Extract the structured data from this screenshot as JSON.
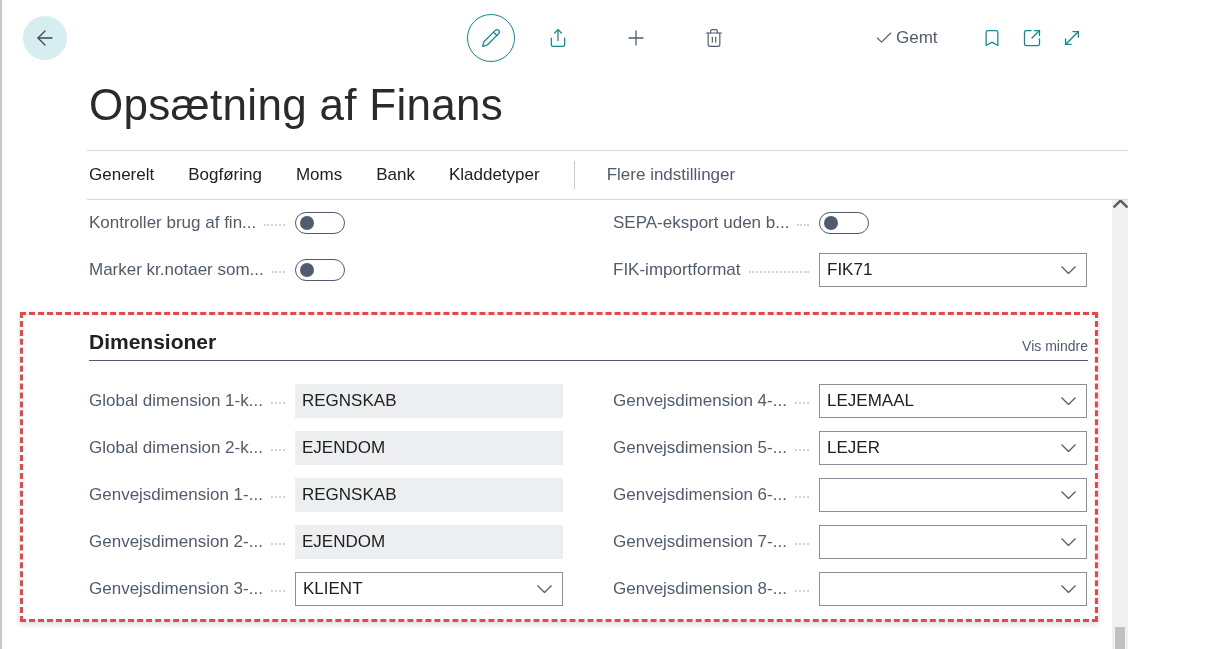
{
  "toolbar": {
    "status": "Gemt"
  },
  "title": "Opsætning af Finans",
  "tabs": [
    {
      "label": "Generelt"
    },
    {
      "label": "Bogføring"
    },
    {
      "label": "Moms"
    },
    {
      "label": "Bank"
    },
    {
      "label": "Kladdetyper"
    }
  ],
  "more_tab": "Flere indstillinger",
  "top_fields": {
    "columns": [
      [
        {
          "label": "Kontroller brug af fin...",
          "kind": "toggle",
          "on": false
        },
        {
          "label": "Marker kr.notaer som...",
          "kind": "toggle",
          "on": false
        }
      ],
      [
        {
          "label": "SEPA-eksport uden b...",
          "kind": "toggle",
          "on": false
        },
        {
          "label": "FIK-importformat",
          "kind": "dropdown",
          "value": "FIK71"
        }
      ]
    ]
  },
  "section": {
    "title": "Dimensioner",
    "toggle_link": "Vis mindre",
    "columns": [
      [
        {
          "label": "Global dimension 1-k...",
          "kind": "readonly",
          "value": "REGNSKAB"
        },
        {
          "label": "Global dimension 2-k...",
          "kind": "readonly",
          "value": "EJENDOM"
        },
        {
          "label": "Genvejsdimension 1-...",
          "kind": "readonly",
          "value": "REGNSKAB"
        },
        {
          "label": "Genvejsdimension 2-...",
          "kind": "readonly",
          "value": "EJENDOM"
        },
        {
          "label": "Genvejsdimension 3-...",
          "kind": "dropdown",
          "value": "KLIENT"
        }
      ],
      [
        {
          "label": "Genvejsdimension 4-...",
          "kind": "dropdown",
          "value": "LEJEMAAL"
        },
        {
          "label": "Genvejsdimension 5-...",
          "kind": "dropdown",
          "value": "LEJER"
        },
        {
          "label": "Genvejsdimension 6-...",
          "kind": "dropdown"
        },
        {
          "label": "Genvejsdimension 7-...",
          "kind": "dropdown"
        },
        {
          "label": "Genvejsdimension 8-...",
          "kind": "dropdown"
        }
      ]
    ]
  }
}
